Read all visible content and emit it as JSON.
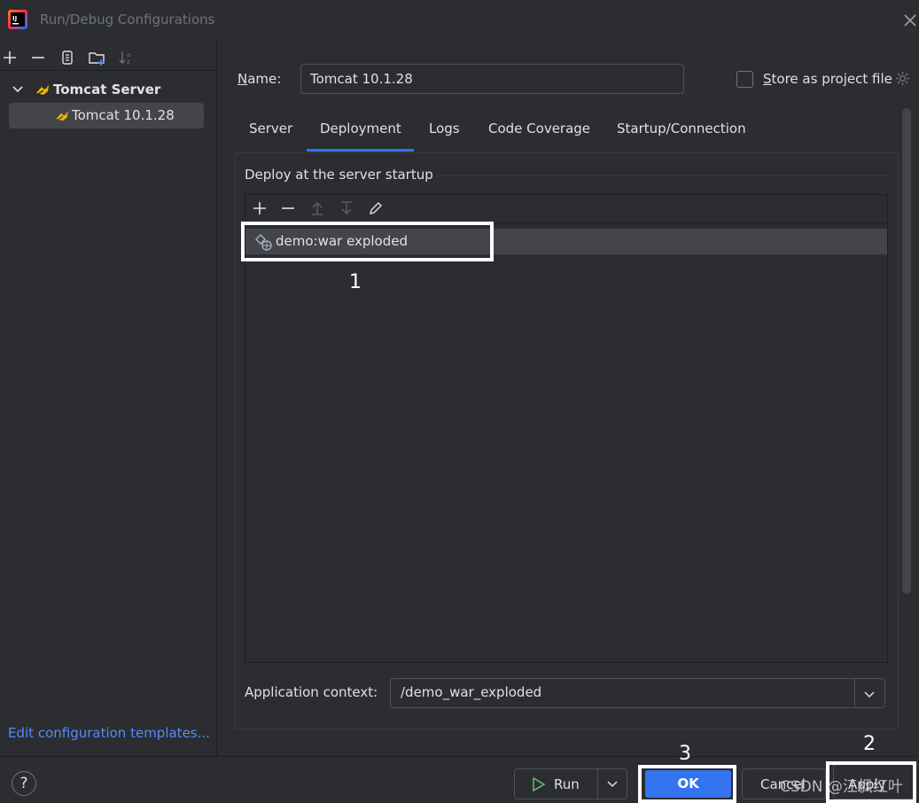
{
  "window": {
    "title": "Run/Debug Configurations"
  },
  "sidebar": {
    "group_label": "Tomcat Server",
    "item_label": "Tomcat 10.1.28",
    "edit_templates_link": "Edit configuration templates..."
  },
  "form": {
    "name_label_prefix": "N",
    "name_label_rest": "ame:",
    "name_value": "Tomcat 10.1.28",
    "store_label_prefix": "S",
    "store_label_rest": "tore as project file",
    "store_checked": false
  },
  "tabs": [
    {
      "label": "Server",
      "active": false
    },
    {
      "label": "Deployment",
      "active": true
    },
    {
      "label": "Logs",
      "active": false
    },
    {
      "label": "Code Coverage",
      "active": false
    },
    {
      "label": "Startup/Connection",
      "active": false
    }
  ],
  "deployment": {
    "section_title": "Deploy at the server startup",
    "artifact_label": "demo:war exploded",
    "context_label": "Application context:",
    "context_value": "/demo_war_exploded"
  },
  "annotations": {
    "n1": "1",
    "n2": "2",
    "n3": "3"
  },
  "buttons": {
    "help": "?",
    "run": "Run",
    "ok": "OK",
    "cancel": "Cancel",
    "apply": "Apply"
  },
  "watermark": "CSDN @江枫红叶",
  "colors": {
    "background": "#2b2d30",
    "accent": "#3574f0",
    "link": "#548af7",
    "selection": "#43454a"
  }
}
